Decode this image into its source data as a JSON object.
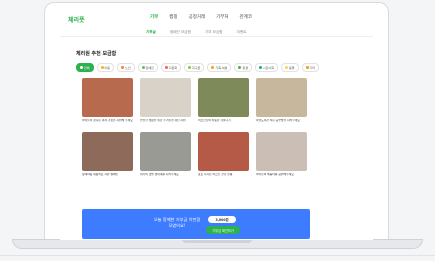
{
  "header": {
    "logo": "체리풋",
    "nav": [
      "기부",
      "캠핑",
      "공정거래",
      "기부처",
      "관계코"
    ],
    "subnav": [
      "기부글",
      "캠페인 모금함",
      "기부 모금함",
      "이벤트"
    ]
  },
  "section": {
    "title": "체리원 추천 모금함"
  },
  "chips": [
    {
      "label": "전체",
      "active": true,
      "color": "#2bb24c"
    },
    {
      "label": "아동",
      "active": false,
      "color": "#ffb400"
    },
    {
      "label": "노인",
      "active": false,
      "color": "#ff7a45"
    },
    {
      "label": "장애인",
      "active": false,
      "color": "#5fbf52"
    },
    {
      "label": "다문화",
      "active": false,
      "color": "#ff5a5a"
    },
    {
      "label": "지구촌",
      "active": false,
      "color": "#8bc34a"
    },
    {
      "label": "가족·여성",
      "active": false,
      "color": "#ffa000"
    },
    {
      "label": "환경",
      "active": false,
      "color": "#4caf50"
    },
    {
      "label": "시민사회",
      "active": false,
      "color": "#26a69a"
    },
    {
      "label": "동물",
      "active": false,
      "color": "#ffd54f"
    },
    {
      "label": "기타",
      "active": false,
      "color": "#ff9800"
    }
  ],
  "cards": [
    {
      "title": "아이들이 꿈꾸는 미래 가정을 지원해 주세요",
      "meta": "",
      "color": "#b86a4e"
    },
    {
      "title": "안전한 생활을 위한 주거환경 개선 지원",
      "meta": "",
      "color": "#d9d2c8"
    },
    {
      "title": "어르신들의 따뜻한 겨울나기",
      "meta": "",
      "color": "#7f8a5a"
    },
    {
      "title": "마을도서관 작은 공부방을 지켜주세요",
      "meta": "",
      "color": "#c7b79c"
    },
    {
      "title": "장애아동 재활치료 지원 캠페인",
      "meta": "",
      "color": "#8e6a5a"
    },
    {
      "title": "위기의 갯벌 생태계를 지켜주세요",
      "meta": "",
      "color": "#9a9a94"
    },
    {
      "title": "홀로 사시는 어르신 건강 돌봄",
      "meta": "",
      "color": "#b65a48"
    },
    {
      "title": "아이들의 배움터를 응원해주세요",
      "meta": "",
      "color": "#cbbfb5"
    }
  ],
  "banner": {
    "text": "오늘 함께한 기부금 이만큼 모였어요!",
    "pill": "3,000원",
    "button": "기부금 확인하기"
  }
}
